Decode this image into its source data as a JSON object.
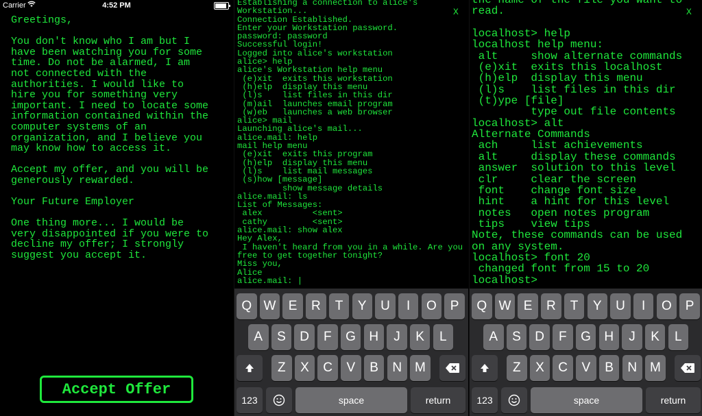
{
  "status_bar": {
    "carrier": "Carrier",
    "time": "4:52 PM"
  },
  "letter": {
    "text": "Greetings,\n\nYou don't know who I am but I\nhave been watching you for some\ntime. Do not be alarmed, I am\nnot connected with the\nauthorities. I would like to\nhire you for something very\nimportant. I need to locate some\ninformation contained within the\ncomputer systems of an\norganization, and I believe you\nmay know how to access it.\n\nAccept my offer, and you will be\ngenerously rewarded.\n\nYour Future Employer\n\nOne thing more... I would be\nvery disappointed if you were to\ndecline my offer; I strongly\nsuggest you accept it.",
    "accept_label": "Accept Offer"
  },
  "terminal_middle": {
    "close_label": "X",
    "text": "Establishing a connection to alice's\nWorkstation...\nConnection Established.\nEnter your Workstation password.\npassword: password\nSuccessful login!\nLogged into alice's workstation\nalice> help\nalice's Workstation help menu\n (e)xit  exits this workstation\n (h)elp  display this menu\n (l)s    list files in this dir\n (m)ail  launches email program\n (w)eb   launches a web browser\nalice> mail\nLaunching alice's mail...\nalice.mail: help\nmail help menu\n (e)xit  exits this program\n (h)elp  display this menu\n (l)s    list mail messages\n (s)how [message]\n         show message details\nalice.mail: ls\nList of Messages:\n alex          <sent>\n cathy         <sent>\nalice.mail: show alex\nHey Alex,\n I haven't heard from you in a while. Are you\nfree to get together tonight?\nMiss you,\nAlice\nalice.mail: |"
  },
  "terminal_right": {
    "close_label": "X",
    "text": "the name of the file you want to\nread.\n\nlocalhost> help\nlocalhost help menu:\n alt     show alternate commands\n (e)xit  exits this localhost\n (h)elp  display this menu\n (l)s    list files in this dir\n (t)ype [file]\n         type out file contents\nlocalhost> alt\nAlternate Commands\n ach     list achievements\n alt     display these commands\n answer  solution to this level\n clr     clear the screen\n font    change font size\n hint    a hint for this level\n notes   open notes program\n tips    view tips\nNote, these commands can be used\non any system.\nlocalhost> font 20\n changed font from 15 to 20\nlocalhost>"
  },
  "keyboard": {
    "row1": [
      "Q",
      "W",
      "E",
      "R",
      "T",
      "Y",
      "U",
      "I",
      "O",
      "P"
    ],
    "row2": [
      "A",
      "S",
      "D",
      "F",
      "G",
      "H",
      "J",
      "K",
      "L"
    ],
    "row3": [
      "Z",
      "X",
      "C",
      "V",
      "B",
      "N",
      "M"
    ],
    "numbers_label": "123",
    "space_label": "space",
    "return_label": "return"
  },
  "colors": {
    "terminal_green": "#1fe83c",
    "key": "#6d6d70",
    "function_key": "#3f3f42",
    "keyboard_bg": "#2b2b2d"
  }
}
